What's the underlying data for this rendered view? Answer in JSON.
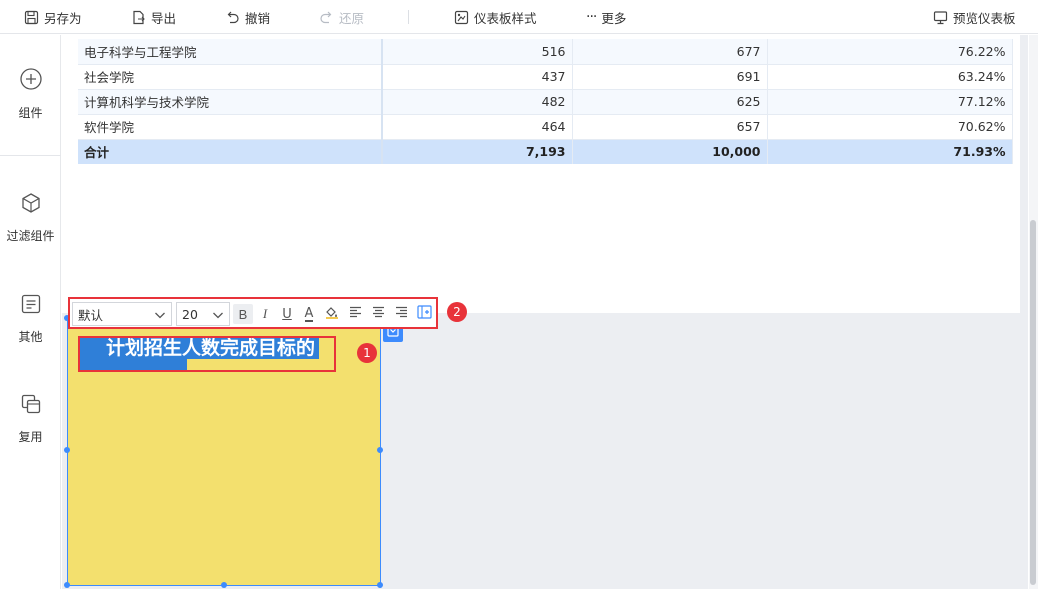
{
  "toolbar": {
    "save_as": "另存为",
    "export": "导出",
    "undo": "撤销",
    "redo": "还原",
    "dashboard_style": "仪表板样式",
    "more": "更多",
    "preview": "预览仪表板"
  },
  "sidebar": {
    "items": [
      {
        "label": "组件",
        "icon": "plus-circle-icon"
      },
      {
        "label": "过滤组件",
        "icon": "cube-icon"
      },
      {
        "label": "其他",
        "icon": "text-card-icon"
      },
      {
        "label": "复用",
        "icon": "copy-layers-icon"
      }
    ]
  },
  "table": {
    "rows": [
      {
        "name": "电子科学与工程学院",
        "v1": "516",
        "v2": "677",
        "rate": "76.22%"
      },
      {
        "name": "社会学院",
        "v1": "437",
        "v2": "691",
        "rate": "63.24%"
      },
      {
        "name": "计算机科学与技术学院",
        "v1": "482",
        "v2": "625",
        "rate": "77.12%"
      },
      {
        "name": "软件学院",
        "v1": "464",
        "v2": "657",
        "rate": "70.62%"
      }
    ],
    "total": {
      "name": "合计",
      "v1": "7,193",
      "v2": "10,000",
      "rate": "71.93%"
    }
  },
  "text_component": {
    "title": "计划招生人数完成目标的",
    "background_color": "#f3e06e",
    "selection_color": "#2f7fd8"
  },
  "format_toolbar": {
    "font_family": "默认",
    "font_size": "20",
    "bold": "B",
    "italic": "I",
    "underline": "U",
    "font_color": "A"
  },
  "annotations": {
    "badge_1": "1",
    "badge_2": "2",
    "color": "#e8333a"
  },
  "colors": {
    "accent": "#3d8bfd",
    "total_row": "#cfe2fb"
  }
}
